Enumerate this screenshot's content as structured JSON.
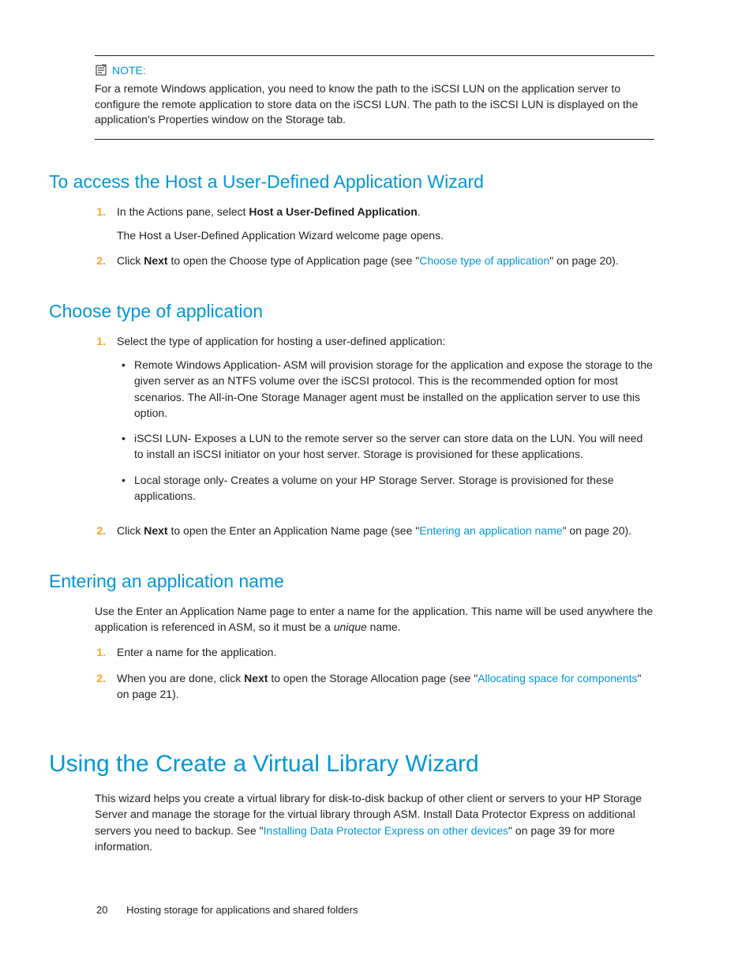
{
  "note": {
    "label": "NOTE:",
    "body": "For a remote Windows application, you need to know the path to the iSCSI LUN on the application server to configure the remote application to store data on the iSCSI LUN. The path to the iSCSI LUN is displayed on the application's Properties window on the Storage tab."
  },
  "section1": {
    "heading": "To access the Host a User-Defined Application Wizard",
    "steps": {
      "n1": "1.",
      "s1a_pre": "In the Actions pane, select ",
      "s1a_bold": "Host a User-Defined Application",
      "s1a_post": ".",
      "s1b": "The Host a User-Defined Application Wizard welcome page opens.",
      "n2": "2.",
      "s2a_pre": "Click ",
      "s2a_bold": "Next",
      "s2a_mid": " to open the Choose type of Application page (see \"",
      "s2a_link": "Choose type of application",
      "s2a_end": "\" on page 20)."
    }
  },
  "section2": {
    "heading": "Choose type of application",
    "steps": {
      "n1": "1.",
      "s1intro": "Select the type of application for hosting a user-defined application:",
      "b1": "Remote Windows Application- ASM will provision storage for the application and expose the storage to the given server as an NTFS volume over the iSCSI protocol. This is the recommended option for most scenarios. The All-in-One Storage Manager agent must be installed on the application server to use this option.",
      "b2": "iSCSI LUN- Exposes a LUN to the remote server so the server can store data on the LUN. You will need to install an iSCSI initiator on your host server. Storage is provisioned for these applications.",
      "b3": "Local storage only- Creates a volume on your HP Storage Server. Storage is provisioned for these applications.",
      "n2": "2.",
      "s2a_pre": "Click ",
      "s2a_bold": "Next",
      "s2a_mid": " to open the Enter an Application Name page (see \"",
      "s2a_link": "Entering an application name",
      "s2a_end": "\" on page 20)."
    }
  },
  "section3": {
    "heading": "Entering an application name",
    "intro_pre": "Use the Enter an Application Name page to enter a name for the application. This name will be used anywhere the application is referenced in ASM, so it must be a ",
    "intro_em": "unique",
    "intro_post": " name.",
    "steps": {
      "n1": "1.",
      "s1": "Enter a name for the application.",
      "n2": "2.",
      "s2a_pre": "When you are done, click ",
      "s2a_bold": "Next",
      "s2a_mid": " to open the Storage Allocation page (see \"",
      "s2a_link": "Allocating space for components",
      "s2a_end": "\" on page 21)."
    }
  },
  "section4": {
    "heading": "Using the Create a Virtual Library Wizard",
    "p_pre": "This wizard helps you create a virtual library for disk-to-disk backup of other client or servers to your HP Storage Server and manage the storage for the virtual library through ASM. Install Data Protector Express on additional servers you need to backup. See \"",
    "p_link": "Installing Data Protector Express on other devices",
    "p_end": "\" on page 39 for more information."
  },
  "footer": {
    "page": "20",
    "title": "Hosting storage for applications and shared folders"
  }
}
